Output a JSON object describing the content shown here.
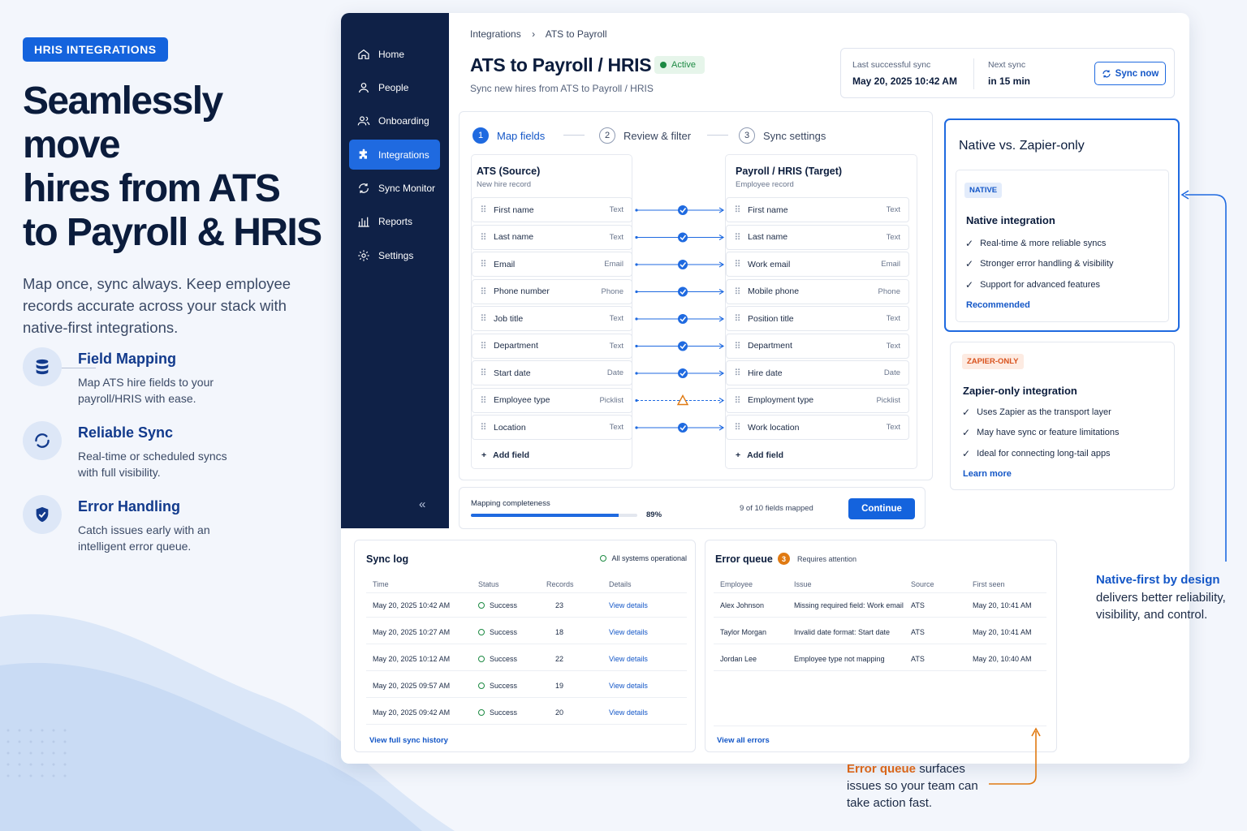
{
  "hero": {
    "pill": "HRIS INTEGRATIONS",
    "title_l1": "Seamlessly move",
    "title_l2": "hires from ATS",
    "title_l3": "to Payroll & HRIS",
    "subtitle": "Map once, sync always. Keep employee records accurate across your stack with native-first integrations."
  },
  "features": [
    {
      "title": "Field Mapping",
      "desc": "Map ATS hire fields to your payroll/HRIS with ease.",
      "icon": "database-icon"
    },
    {
      "title": "Reliable Sync",
      "desc": "Real-time or scheduled syncs with full visibility.",
      "icon": "sync-circle-icon"
    },
    {
      "title": "Error Handling",
      "desc": "Catch issues early with an intelligent error queue.",
      "icon": "shield-check-icon"
    }
  ],
  "sidebar": {
    "items": [
      {
        "label": "Home",
        "icon": "home-icon"
      },
      {
        "label": "People",
        "icon": "person-icon"
      },
      {
        "label": "Onboarding",
        "icon": "people-icon"
      },
      {
        "label": "Integrations",
        "icon": "puzzle-icon",
        "active": true
      },
      {
        "label": "Sync Monitor",
        "icon": "sync-monitor-icon"
      },
      {
        "label": "Reports",
        "icon": "bar-chart-icon"
      },
      {
        "label": "Settings",
        "icon": "gear-icon"
      }
    ],
    "collapse": "«"
  },
  "header": {
    "breadcrumb_1": "Integrations",
    "breadcrumb_sep": "›",
    "breadcrumb_2": "ATS to Payroll",
    "title": "ATS to Payroll / HRIS",
    "status": "Active",
    "subtitle": "Sync new hires from ATS to Payroll / HRIS"
  },
  "sync": {
    "last_label": "Last successful sync",
    "last_value": "May 20, 2025 10:42 AM",
    "next_label": "Next sync",
    "next_value": "in 15 min",
    "button": "Sync now"
  },
  "steps": [
    {
      "num": "1",
      "label": "Map fields"
    },
    {
      "num": "2",
      "label": "Review & filter"
    },
    {
      "num": "3",
      "label": "Sync settings"
    }
  ],
  "mapping": {
    "source_title": "ATS (Source)",
    "source_sub": "New hire record",
    "target_title": "Payroll / HRIS (Target)",
    "target_sub": "Employee record",
    "rows": [
      {
        "src": "First name",
        "src_type": "Text",
        "dst": "First name",
        "dst_type": "Text",
        "status": "ok"
      },
      {
        "src": "Last name",
        "src_type": "Text",
        "dst": "Last name",
        "dst_type": "Text",
        "status": "ok"
      },
      {
        "src": "Email",
        "src_type": "Email",
        "dst": "Work email",
        "dst_type": "Email",
        "status": "ok"
      },
      {
        "src": "Phone number",
        "src_type": "Phone",
        "dst": "Mobile phone",
        "dst_type": "Phone",
        "status": "ok"
      },
      {
        "src": "Job title",
        "src_type": "Text",
        "dst": "Position title",
        "dst_type": "Text",
        "status": "ok"
      },
      {
        "src": "Department",
        "src_type": "Text",
        "dst": "Department",
        "dst_type": "Text",
        "status": "ok"
      },
      {
        "src": "Start date",
        "src_type": "Date",
        "dst": "Hire date",
        "dst_type": "Date",
        "status": "ok"
      },
      {
        "src": "Employee type",
        "src_type": "Picklist",
        "dst": "Employment type",
        "dst_type": "Picklist",
        "status": "warn"
      },
      {
        "src": "Location",
        "src_type": "Text",
        "dst": "Work location",
        "dst_type": "Text",
        "status": "ok"
      }
    ],
    "add_field": "Add field"
  },
  "completeness": {
    "label": "Mapping completeness",
    "percent": 89,
    "percent_text": "89%",
    "mapped_text": "9 of 10 fields mapped",
    "button": "Continue"
  },
  "native_card": {
    "title": "Native vs. Zapier-only",
    "tag": "NATIVE",
    "heading": "Native integration",
    "points": [
      "Real-time & more reliable syncs",
      "Stronger error handling & visibility",
      "Support for advanced features"
    ],
    "link": "Recommended"
  },
  "zapier_card": {
    "tag": "ZAPIER-ONLY",
    "heading": "Zapier-only integration",
    "points": [
      "Uses Zapier as the transport layer",
      "May have sync or feature limitations",
      "Ideal for connecting long-tail apps"
    ],
    "link": "Learn more"
  },
  "sync_log": {
    "title": "Sync log",
    "status": "All systems operational",
    "columns": [
      "Time",
      "Status",
      "Records",
      "Details"
    ],
    "rows": [
      {
        "time": "May 20, 2025 10:42 AM",
        "status": "Success",
        "records": "23",
        "details": "View details"
      },
      {
        "time": "May 20, 2025 10:27 AM",
        "status": "Success",
        "records": "18",
        "details": "View details"
      },
      {
        "time": "May 20, 2025 10:12 AM",
        "status": "Success",
        "records": "22",
        "details": "View details"
      },
      {
        "time": "May 20, 2025 09:57 AM",
        "status": "Success",
        "records": "19",
        "details": "View details"
      },
      {
        "time": "May 20, 2025 09:42 AM",
        "status": "Success",
        "records": "20",
        "details": "View details"
      }
    ],
    "footer_link": "View full sync history"
  },
  "error_queue": {
    "title": "Error queue",
    "count": "3",
    "note": "Requires attention",
    "columns": [
      "Employee",
      "Issue",
      "Source",
      "First seen"
    ],
    "rows": [
      {
        "employee": "Alex Johnson",
        "issue": "Missing required field: Work email",
        "source": "ATS",
        "first_seen": "May 20, 10:41 AM"
      },
      {
        "employee": "Taylor Morgan",
        "issue": "Invalid date format: Start date",
        "source": "ATS",
        "first_seen": "May 20, 10:41 AM"
      },
      {
        "employee": "Jordan Lee",
        "issue": "Employee type not mapping",
        "source": "ATS",
        "first_seen": "May 20, 10:40 AM"
      }
    ],
    "footer_link": "View all errors"
  },
  "callouts": {
    "native_hl": "Native-first by design",
    "native_rest": "delivers better reliability, visibility, and control.",
    "error_hl": "Error queue",
    "error_rest": " surfaces issues so your team can take action fast."
  },
  "colors": {
    "primary": "#1463dd",
    "navy": "#0f2147",
    "success": "#1d8a43",
    "warning": "#e07a12",
    "zapier_tag": "#d9531e"
  }
}
